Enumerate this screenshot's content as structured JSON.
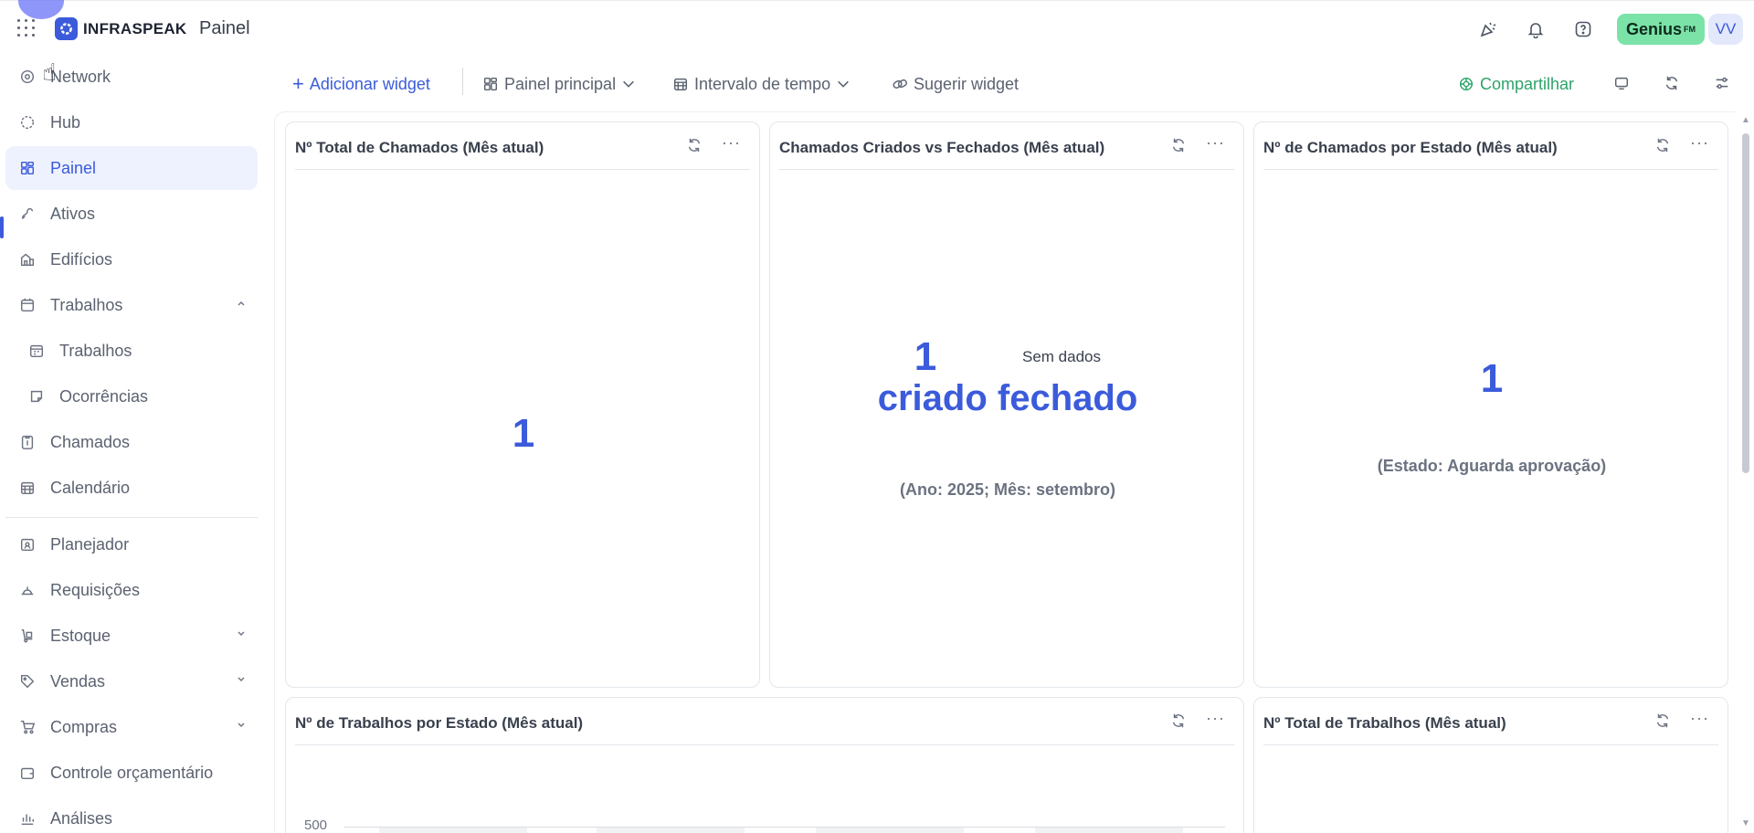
{
  "header": {
    "brand": "INFRASPEAK",
    "page_name": "Painel",
    "genius_label": "Genius",
    "genius_suffix": "FM",
    "avatar_initials": "VV"
  },
  "sidebar": {
    "items": [
      {
        "label": "Network"
      },
      {
        "label": "Hub"
      },
      {
        "label": "Painel"
      },
      {
        "label": "Ativos"
      },
      {
        "label": "Edifícios"
      },
      {
        "label": "Trabalhos"
      },
      {
        "label": "Trabalhos"
      },
      {
        "label": "Ocorrências"
      },
      {
        "label": "Chamados"
      },
      {
        "label": "Calendário"
      },
      {
        "label": "Planejador"
      },
      {
        "label": "Requisições"
      },
      {
        "label": "Estoque"
      },
      {
        "label": "Vendas"
      },
      {
        "label": "Compras"
      },
      {
        "label": "Controle orçamentário"
      },
      {
        "label": "Análises"
      }
    ]
  },
  "toolbar": {
    "add_widget": "Adicionar widget",
    "dashboard_select": "Painel principal",
    "time_range": "Intervalo de tempo",
    "suggest_widget": "Sugerir widget",
    "share": "Compartilhar"
  },
  "widgets": {
    "total_tickets": {
      "title": "Nº Total de Chamados (Mês atual)",
      "value": "1"
    },
    "created_vs_closed": {
      "title": "Chamados Criados vs Fechados (Mês atual)",
      "value": "1",
      "no_data": "Sem dados",
      "labels": "criado fechado",
      "caption": "(Ano: 2025; Mês: setembro)"
    },
    "tickets_by_state": {
      "title": "Nº de Chamados por Estado (Mês atual)",
      "value": "1",
      "caption": "(Estado: Aguarda aprovação)"
    },
    "works_by_state": {
      "title": "Nº de Trabalhos por Estado (Mês atual)",
      "y_tick": "500"
    },
    "total_works": {
      "title": "Nº Total de Trabalhos (Mês atual)"
    }
  }
}
